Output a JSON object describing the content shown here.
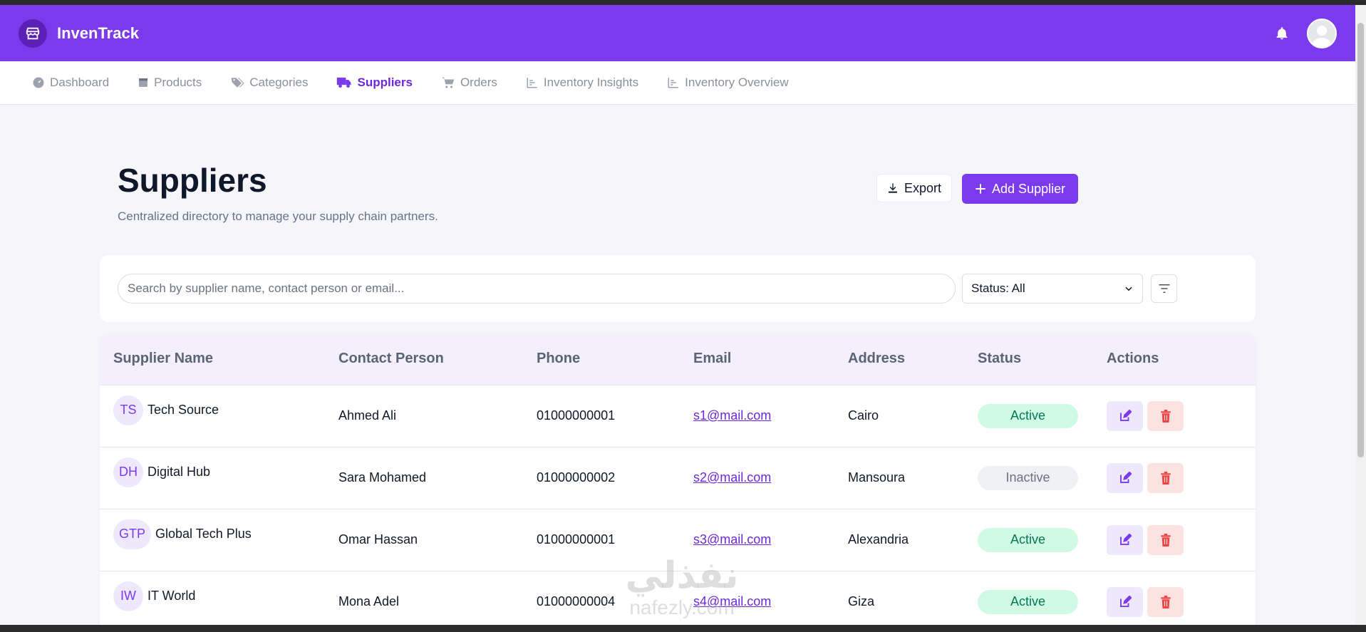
{
  "app": {
    "name": "InvenTrack"
  },
  "nav": [
    {
      "label": "Dashboard",
      "icon": "dashboard-icon",
      "active": false
    },
    {
      "label": "Products",
      "icon": "box-icon",
      "active": false
    },
    {
      "label": "Categories",
      "icon": "tags-icon",
      "active": false
    },
    {
      "label": "Suppliers",
      "icon": "truck-icon",
      "active": true
    },
    {
      "label": "Orders",
      "icon": "cart-icon",
      "active": false
    },
    {
      "label": "Inventory Insights",
      "icon": "chart-icon",
      "active": false
    },
    {
      "label": "Inventory Overview",
      "icon": "chart-icon",
      "active": false
    }
  ],
  "page": {
    "title": "Suppliers",
    "subtitle": "Centralized directory to manage your supply chain partners.",
    "export_label": "Export",
    "add_label": "Add Supplier"
  },
  "filters": {
    "search_placeholder": "Search by supplier name, contact person or email...",
    "status_value": "Status: All"
  },
  "table": {
    "headers": [
      "Supplier Name",
      "Contact Person",
      "Phone",
      "Email",
      "Address",
      "Status",
      "Actions"
    ],
    "rows": [
      {
        "initials": "TS",
        "name": "Tech Source",
        "contact": "Ahmed Ali",
        "phone": "01000000001",
        "email": "s1@mail.com",
        "address": "Cairo",
        "status": "Active"
      },
      {
        "initials": "DH",
        "name": "Digital Hub",
        "contact": "Sara Mohamed",
        "phone": "01000000002",
        "email": "s2@mail.com",
        "address": "Mansoura",
        "status": "Inactive"
      },
      {
        "initials": "GTP",
        "name": "Global Tech Plus",
        "contact": "Omar Hassan",
        "phone": "01000000001",
        "email": "s3@mail.com",
        "address": "Alexandria",
        "status": "Active"
      },
      {
        "initials": "IW",
        "name": "IT World",
        "contact": "Mona Adel",
        "phone": "01000000004",
        "email": "s4@mail.com",
        "address": "Giza",
        "status": "Active"
      }
    ]
  },
  "watermark": {
    "arabic": "نفذلي",
    "latin": "nafezly.com"
  },
  "colors": {
    "brand": "#7c3aed",
    "active_badge": "#d1fae5",
    "inactive_badge": "#eef0f4",
    "danger": "#ef4444"
  }
}
